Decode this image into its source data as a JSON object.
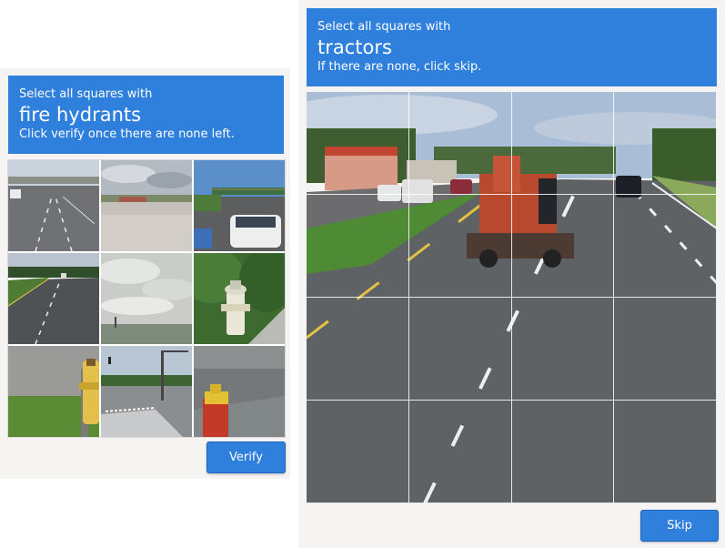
{
  "left_challenge": {
    "prompt_intro": "Select all squares with",
    "target": "fire hydrants",
    "instruction": "Click verify once there are none left.",
    "button_label": "Verify",
    "tiles": [
      "highway-overpass",
      "parking-lot",
      "car-and-bridge",
      "road-with-trees",
      "cloudy-sky",
      "fire-hydrant-grass",
      "fire-hydrant-roadside",
      "intersection",
      "fire-hydrant-yellow"
    ]
  },
  "right_challenge": {
    "prompt_intro": "Select all squares with",
    "target": "tractors",
    "instruction": "If there are none, click skip.",
    "button_label": "Skip",
    "grid_rows": 4,
    "grid_cols": 4
  },
  "colors": {
    "accent": "#2f7fdd",
    "panel": "#f5f4f2"
  }
}
